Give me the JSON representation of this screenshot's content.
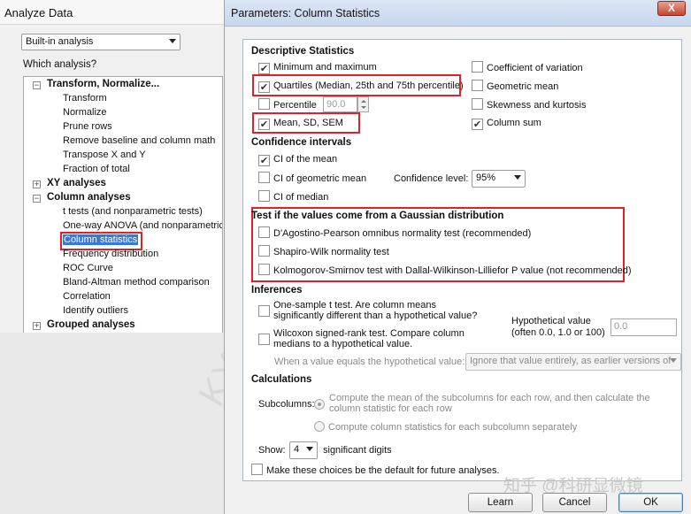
{
  "analyze_window": {
    "title": "Analyze Data",
    "analysis_type": "Built-in analysis",
    "which_label": "Which analysis?",
    "tree": [
      {
        "type": "category",
        "expander": "−",
        "label": "Transform, Normalize..."
      },
      {
        "type": "item",
        "label": "Transform"
      },
      {
        "type": "item",
        "label": "Normalize"
      },
      {
        "type": "item",
        "label": "Prune rows"
      },
      {
        "type": "item",
        "label": "Remove baseline and column math"
      },
      {
        "type": "item",
        "label": "Transpose X and Y"
      },
      {
        "type": "item",
        "label": "Fraction of total"
      },
      {
        "type": "category",
        "expander": "+",
        "label": "XY analyses"
      },
      {
        "type": "category",
        "expander": "−",
        "label": "Column analyses"
      },
      {
        "type": "item",
        "label": "t tests (and nonparametric tests)"
      },
      {
        "type": "item",
        "label": "One-way ANOVA (and nonparametric)"
      },
      {
        "type": "item",
        "label": "Column statistics",
        "selected": true
      },
      {
        "type": "item",
        "label": "Frequency distribution"
      },
      {
        "type": "item",
        "label": "ROC Curve"
      },
      {
        "type": "item",
        "label": "Bland-Altman method comparison"
      },
      {
        "type": "item",
        "label": "Correlation"
      },
      {
        "type": "item",
        "label": "Identify outliers"
      },
      {
        "type": "category",
        "expander": "+",
        "label": "Grouped analyses"
      }
    ],
    "watermark": "KY"
  },
  "params_dialog": {
    "title": "Parameters: Column Statistics",
    "close_label": "X",
    "descriptive": {
      "heading": "Descriptive Statistics",
      "min_max": "Minimum and maximum",
      "quartiles": "Quartiles (Median, 25th and 75th percentile)",
      "percentile": "Percentile",
      "percentile_value": "90.0",
      "mean_sd_sem": "Mean, SD, SEM",
      "coef_variation": "Coefficient of variation",
      "geometric_mean": "Geometric mean",
      "skew_kurtosis": "Skewness and kurtosis",
      "column_sum": "Column sum"
    },
    "confidence": {
      "heading": "Confidence intervals",
      "ci_mean": "CI of the mean",
      "ci_geo_mean": "CI of geometric mean",
      "ci_median": "CI of median",
      "level_label": "Confidence level:",
      "level_value": "95%"
    },
    "gaussian": {
      "heading": "Test if the values come from a Gaussian distribution",
      "dagostino": "D'Agostino-Pearson omnibus normality test (recommended)",
      "shapiro": "Shapiro-Wilk normality test",
      "ks": "Kolmogorov-Smirnov test with Dallal-Wilkinson-Lilliefor P value (not recommended)"
    },
    "inferences": {
      "heading": "Inferences",
      "one_sample_t": "One-sample t test. Are column means significantly different than a hypothetical value?",
      "wilcoxon": "Wilcoxon signed-rank test. Compare column medians to a hypothetical value.",
      "hypo_label_line1": "Hypothetical value",
      "hypo_label_line2": "(often 0.0, 1.0 or 100)",
      "hypo_value": "0.0",
      "equals_label": "When a value equals the hypothetical value:",
      "equals_value": "Ignore that value entirely, as earlier versions of"
    },
    "calculations": {
      "heading": "Calculations",
      "subcolumns_label": "Subcolumns:",
      "option_mean": "Compute the mean of the subcolumns for each row, and then calculate the column statistic for each row",
      "option_each": "Compute column statistics for each subcolumn separately",
      "show_label": "Show:",
      "digits_value": "4",
      "digits_label": "significant digits"
    },
    "default_checkbox": "Make these choices be the default for future analyses.",
    "buttons": {
      "learn": "Learn",
      "cancel": "Cancel",
      "ok": "OK"
    },
    "watermark": "知乎 @科研显微镜"
  },
  "checked_states": {
    "min_max": true,
    "quartiles": true,
    "percentile": false,
    "mean_sd_sem": true,
    "coef_variation": false,
    "geometric_mean": false,
    "skew_kurtosis": false,
    "column_sum": true,
    "ci_mean": true,
    "ci_geo_mean": false,
    "ci_median": false,
    "dagostino": false,
    "shapiro": false,
    "ks": false,
    "one_sample_t": false,
    "wilcoxon": false,
    "default": false
  },
  "colors": {
    "highlight_red": "#e0202a",
    "selection_blue": "#3a78d8"
  }
}
